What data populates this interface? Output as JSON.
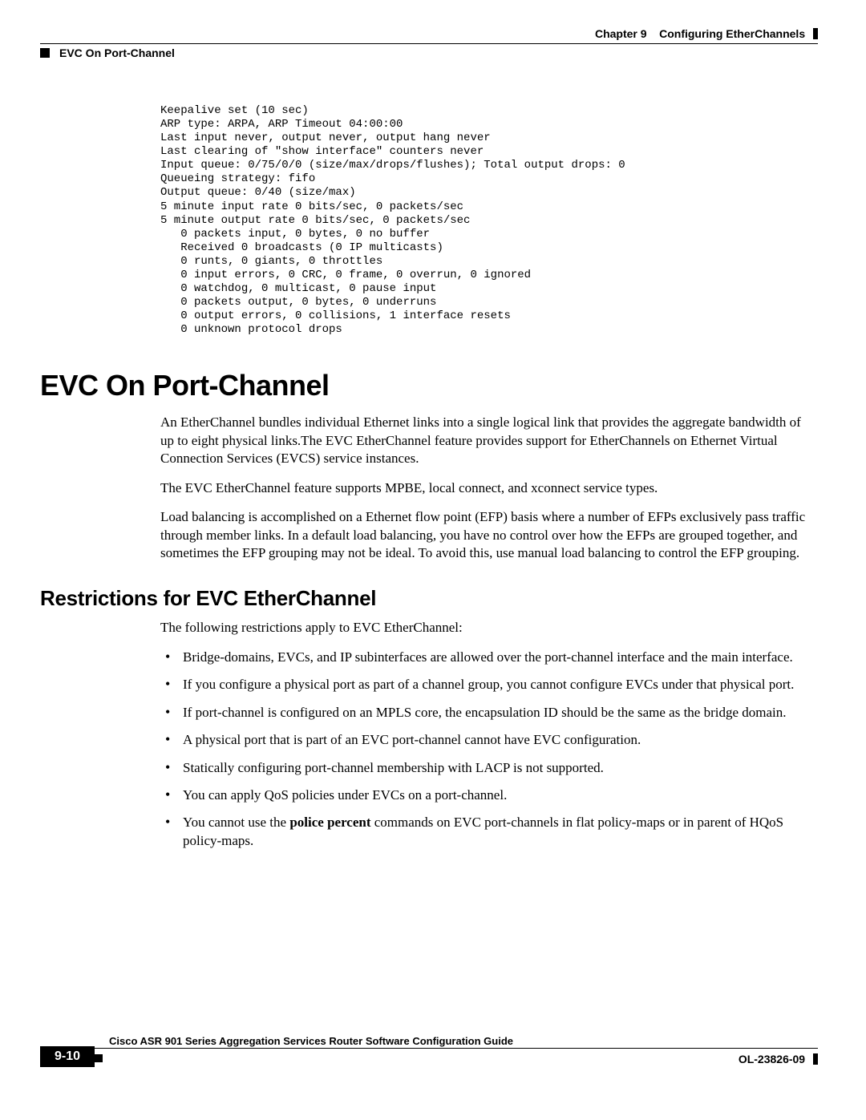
{
  "header": {
    "chapter_label": "Chapter 9",
    "chapter_title": "Configuring EtherChannels",
    "section_ref": "EVC On Port-Channel"
  },
  "terminal_output": "Keepalive set (10 sec)\nARP type: ARPA, ARP Timeout 04:00:00\nLast input never, output never, output hang never\nLast clearing of \"show interface\" counters never\nInput queue: 0/75/0/0 (size/max/drops/flushes); Total output drops: 0\nQueueing strategy: fifo\nOutput queue: 0/40 (size/max)\n5 minute input rate 0 bits/sec, 0 packets/sec\n5 minute output rate 0 bits/sec, 0 packets/sec\n   0 packets input, 0 bytes, 0 no buffer\n   Received 0 broadcasts (0 IP multicasts)\n   0 runts, 0 giants, 0 throttles\n   0 input errors, 0 CRC, 0 frame, 0 overrun, 0 ignored\n   0 watchdog, 0 multicast, 0 pause input\n   0 packets output, 0 bytes, 0 underruns\n   0 output errors, 0 collisions, 1 interface resets\n   0 unknown protocol drops",
  "section": {
    "title": "EVC On Port-Channel",
    "p1": "An EtherChannel bundles individual Ethernet links into a single logical link that provides the aggregate bandwidth of up to eight physical links.The EVC EtherChannel feature provides support for EtherChannels on Ethernet Virtual Connection Services (EVCS) service instances.",
    "p2": "The EVC EtherChannel feature supports MPBE, local connect, and xconnect service types.",
    "p3": "Load balancing is accomplished on a Ethernet flow point (EFP) basis where a number of EFPs exclusively pass traffic through member links. In a default load balancing, you have no control over how the EFPs are grouped together, and sometimes the EFP grouping may not be ideal. To avoid this, use manual load balancing to control the EFP grouping."
  },
  "subsection": {
    "title": "Restrictions for EVC EtherChannel",
    "intro": "The following restrictions apply to EVC EtherChannel:",
    "bullets": [
      "Bridge-domains, EVCs, and IP subinterfaces are allowed over the port-channel interface and the main interface.",
      "If you configure a physical port as part of a channel group, you cannot configure EVCs under that physical port.",
      "If port-channel is configured on an MPLS core, the encapsulation ID should be the same as the bridge domain.",
      "A physical port that is part of an EVC port-channel cannot have EVC configuration.",
      "Statically configuring port-channel membership with LACP is not supported.",
      "You can apply QoS policies under EVCs on a port-channel."
    ],
    "bullet_last_pre": "You cannot use the ",
    "bullet_last_bold": "police percent",
    "bullet_last_post": " commands on EVC port-channels in flat policy-maps or in parent of HQoS policy-maps."
  },
  "footer": {
    "guide_title": "Cisco ASR 901 Series Aggregation Services Router Software Configuration Guide",
    "page_number": "9-10",
    "doc_id": "OL-23826-09"
  }
}
